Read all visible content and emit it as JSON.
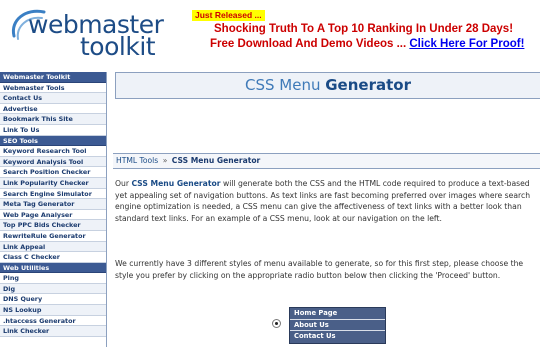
{
  "header": {
    "logo_top": "webmaster",
    "logo_bottom": "toolkit",
    "promo_badge": "Just Released ...",
    "promo_line1": "Shocking Truth To A Top 10 Ranking In Under 28 Days!",
    "promo_line2_text": "Free Download And Demo Videos ...",
    "promo_line2_link": "Click Here For Proof!",
    "colors": {
      "logo": "#1d4c86",
      "promo_text": "#cc0000",
      "badge_bg": "#ffff00",
      "link": "#0000ee"
    }
  },
  "sidebar": {
    "items": [
      {
        "label": "Webmaster Toolkit",
        "kind": "header"
      },
      {
        "label": "Webmaster Tools",
        "kind": "link"
      },
      {
        "label": "Contact Us",
        "kind": "link"
      },
      {
        "label": "Advertise",
        "kind": "link"
      },
      {
        "label": "Bookmark This Site",
        "kind": "link"
      },
      {
        "label": "Link To Us",
        "kind": "link"
      },
      {
        "label": "SEO Tools",
        "kind": "header"
      },
      {
        "label": "Keyword Research Tool",
        "kind": "link"
      },
      {
        "label": "Keyword Analysis Tool",
        "kind": "link"
      },
      {
        "label": "Search Position Checker",
        "kind": "link"
      },
      {
        "label": "Link Popularity Checker",
        "kind": "link"
      },
      {
        "label": "Search Engine Simulator",
        "kind": "link"
      },
      {
        "label": "Meta Tag Generator",
        "kind": "link"
      },
      {
        "label": "Web Page Analyser",
        "kind": "link"
      },
      {
        "label": "Top PPC Bids Checker",
        "kind": "link"
      },
      {
        "label": "RewriteRule Generator",
        "kind": "link"
      },
      {
        "label": "Link Appeal",
        "kind": "link"
      },
      {
        "label": "Class C Checker",
        "kind": "link"
      },
      {
        "label": "Web Utilities",
        "kind": "header"
      },
      {
        "label": "Ping",
        "kind": "link"
      },
      {
        "label": "Dig",
        "kind": "link"
      },
      {
        "label": "DNS Query",
        "kind": "link"
      },
      {
        "label": "NS Lookup",
        "kind": "link"
      },
      {
        "label": ".htaccess Generator",
        "kind": "link"
      },
      {
        "label": "Link Checker",
        "kind": "link"
      }
    ],
    "colors": {
      "header_bg": "#3c5a93",
      "link_text": "#1a3a6e"
    }
  },
  "main": {
    "title_light": "CSS Menu",
    "title_strong": "Generator",
    "breadcrumb": {
      "parent": "HTML Tools",
      "separator": "»",
      "current": "CSS Menu Generator"
    },
    "intro_prefix": "Our",
    "intro_strong": "CSS Menu Generator",
    "intro_rest": "will generate both the CSS and the HTML code required to produce a text-based yet appealing set of navigation buttons. As text links are fast becoming preferred over images where search engine optimization is needed, a CSS menu can give the affectiveness of text links with a better look than standard text links. For an example of a CSS menu, look at our navigation on the left.",
    "styles_text": "We currently have 3 different styles of menu available to generate, so for this first step, please choose the style you prefer by clicking on the appropriate radio button below then clicking the 'Proceed' button.",
    "sample_menu": [
      "Home Page",
      "About Us",
      "Contact Us"
    ],
    "colors": {
      "accent": "#1a4b86",
      "sample_menu_bg": "#4a5f88"
    }
  }
}
